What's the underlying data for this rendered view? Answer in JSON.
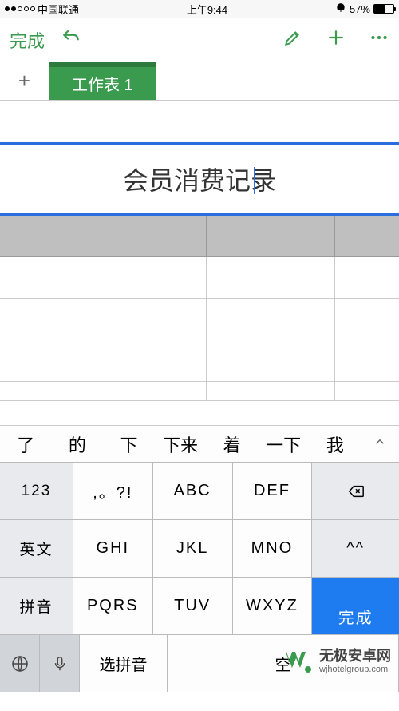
{
  "status": {
    "carrier": "中国联通",
    "time": "上午9:44",
    "battery_pct": "57%"
  },
  "toolbar": {
    "done_label": "完成"
  },
  "tabs": {
    "sheet1_label": "工作表 1"
  },
  "sheet": {
    "title_text": "会员消费记录"
  },
  "candidates": [
    "了",
    "的",
    "下",
    "下来",
    "着",
    "一下",
    "我"
  ],
  "keyboard": {
    "r1": {
      "k0": "123",
      "k1": ",。?!",
      "k2": "ABC",
      "k3": "DEF"
    },
    "r2": {
      "k0": "英文",
      "k1": "GHI",
      "k2": "JKL",
      "k3": "MNO",
      "k4": "^^"
    },
    "r3": {
      "k0": "拼音",
      "k1": "PQRS",
      "k2": "TUV",
      "k3": "WXYZ"
    },
    "bottom": {
      "select_pinyin": "选拼音",
      "space": "空",
      "done": "完成"
    }
  },
  "watermark": {
    "cn": "无极安卓网",
    "en": "wjhotelgroup.com"
  }
}
